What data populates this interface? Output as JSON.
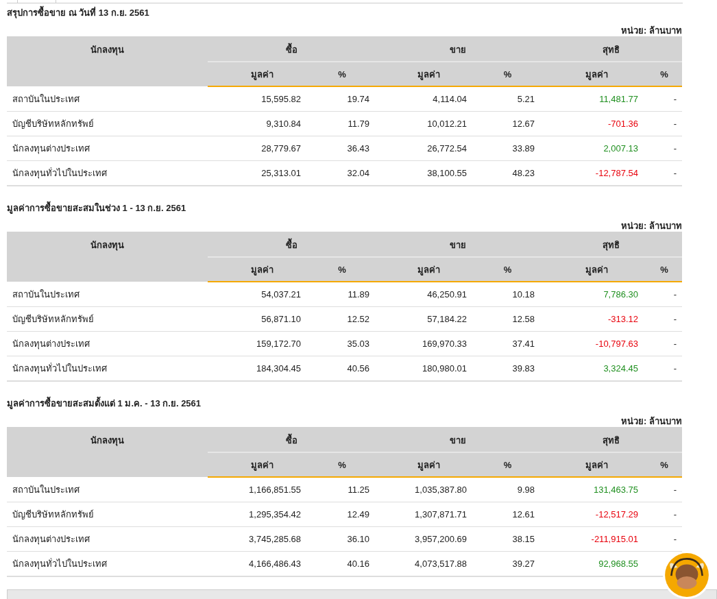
{
  "sections": [
    {
      "title": "สรุปการซื้อขาย ณ วันที่ 13 ก.ย. 2561",
      "unit": "หน่วย: ล้านบาท",
      "header": {
        "investor": "นักลงทุน",
        "groups": [
          "ซื้อ",
          "ขาย",
          "สุทธิ"
        ],
        "subcolumns": [
          "มูลค่า",
          "%",
          "มูลค่า",
          "%",
          "มูลค่า",
          "%"
        ]
      },
      "rows": [
        {
          "investor": "สถาบันในประเทศ",
          "buy_value": "15,595.82",
          "buy_pct": "19.74",
          "sell_value": "4,114.04",
          "sell_pct": "5.21",
          "net": {
            "value": "11,481.77",
            "color": "#1f8f1f"
          },
          "net_pct": "-"
        },
        {
          "investor": "บัญชีบริษัทหลักทรัพย์",
          "buy_value": "9,310.84",
          "buy_pct": "11.79",
          "sell_value": "10,012.21",
          "sell_pct": "12.67",
          "net": {
            "value": "-701.36",
            "color": "#e8000b"
          },
          "net_pct": "-"
        },
        {
          "investor": "นักลงทุนต่างประเทศ",
          "buy_value": "28,779.67",
          "buy_pct": "36.43",
          "sell_value": "26,772.54",
          "sell_pct": "33.89",
          "net": {
            "value": "2,007.13",
            "color": "#1f8f1f"
          },
          "net_pct": "-"
        },
        {
          "investor": "นักลงทุนทั่วไปในประเทศ",
          "buy_value": "25,313.01",
          "buy_pct": "32.04",
          "sell_value": "38,100.55",
          "sell_pct": "48.23",
          "net": {
            "value": "-12,787.54",
            "color": "#e8000b"
          },
          "net_pct": "-"
        }
      ]
    },
    {
      "title": "มูลค่าการซื้อขายสะสมในช่วง 1 - 13 ก.ย. 2561",
      "unit": "หน่วย: ล้านบาท",
      "header": {
        "investor": "นักลงทุน",
        "groups": [
          "ซื้อ",
          "ขาย",
          "สุทธิ"
        ],
        "subcolumns": [
          "มูลค่า",
          "%",
          "มูลค่า",
          "%",
          "มูลค่า",
          "%"
        ]
      },
      "rows": [
        {
          "investor": "สถาบันในประเทศ",
          "buy_value": "54,037.21",
          "buy_pct": "11.89",
          "sell_value": "46,250.91",
          "sell_pct": "10.18",
          "net": {
            "value": "7,786.30",
            "color": "#1f8f1f"
          },
          "net_pct": "-"
        },
        {
          "investor": "บัญชีบริษัทหลักทรัพย์",
          "buy_value": "56,871.10",
          "buy_pct": "12.52",
          "sell_value": "57,184.22",
          "sell_pct": "12.58",
          "net": {
            "value": "-313.12",
            "color": "#e8000b"
          },
          "net_pct": "-"
        },
        {
          "investor": "นักลงทุนต่างประเทศ",
          "buy_value": "159,172.70",
          "buy_pct": "35.03",
          "sell_value": "169,970.33",
          "sell_pct": "37.41",
          "net": {
            "value": "-10,797.63",
            "color": "#e8000b"
          },
          "net_pct": "-"
        },
        {
          "investor": "นักลงทุนทั่วไปในประเทศ",
          "buy_value": "184,304.45",
          "buy_pct": "40.56",
          "sell_value": "180,980.01",
          "sell_pct": "39.83",
          "net": {
            "value": "3,324.45",
            "color": "#1f8f1f"
          },
          "net_pct": "-"
        }
      ]
    },
    {
      "title": "มูลค่าการซื้อขายสะสมตั้งแต่ 1 ม.ค. - 13 ก.ย. 2561",
      "unit": "หน่วย: ล้านบาท",
      "header": {
        "investor": "นักลงทุน",
        "groups": [
          "ซื้อ",
          "ขาย",
          "สุทธิ"
        ],
        "subcolumns": [
          "มูลค่า",
          "%",
          "มูลค่า",
          "%",
          "มูลค่า",
          "%"
        ]
      },
      "rows": [
        {
          "investor": "สถาบันในประเทศ",
          "buy_value": "1,166,851.55",
          "buy_pct": "11.25",
          "sell_value": "1,035,387.80",
          "sell_pct": "9.98",
          "net": {
            "value": "131,463.75",
            "color": "#1f8f1f"
          },
          "net_pct": "-"
        },
        {
          "investor": "บัญชีบริษัทหลักทรัพย์",
          "buy_value": "1,295,354.42",
          "buy_pct": "12.49",
          "sell_value": "1,307,871.71",
          "sell_pct": "12.61",
          "net": {
            "value": "-12,517.29",
            "color": "#e8000b"
          },
          "net_pct": "-"
        },
        {
          "investor": "นักลงทุนต่างประเทศ",
          "buy_value": "3,745,285.68",
          "buy_pct": "36.10",
          "sell_value": "3,957,200.69",
          "sell_pct": "38.15",
          "net": {
            "value": "-211,915.01",
            "color": "#e8000b"
          },
          "net_pct": "-"
        },
        {
          "investor": "นักลงทุนทั่วไปในประเทศ",
          "buy_value": "4,166,486.43",
          "buy_pct": "40.16",
          "sell_value": "4,073,517.88",
          "sell_pct": "39.27",
          "net": {
            "value": "92,968.55",
            "color": "#1f8f1f"
          }
        }
      ]
    }
  ]
}
